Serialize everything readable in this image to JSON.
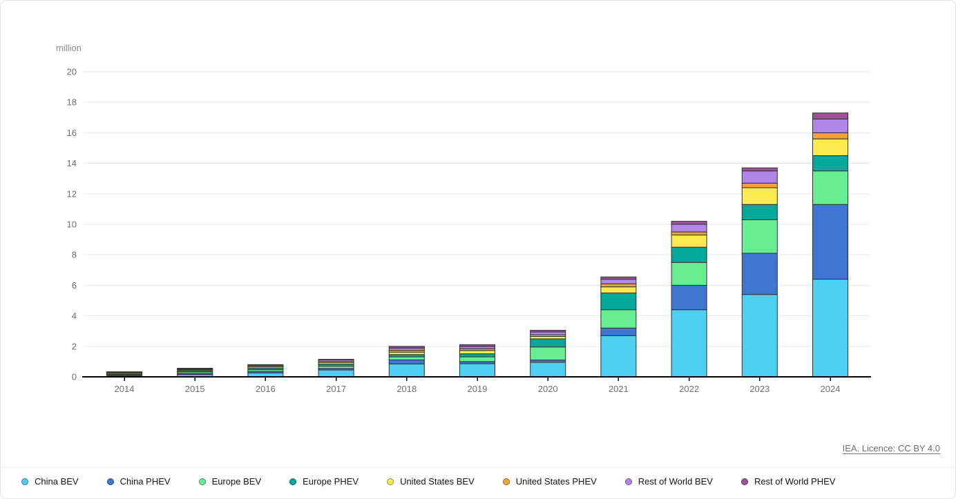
{
  "source": {
    "label": "IEA. Licence: CC BY 4.0"
  },
  "chart_data": {
    "type": "bar",
    "stacked": true,
    "title": "",
    "unit_label": "million",
    "xlabel": "",
    "ylabel": "million",
    "ylim": [
      0,
      20
    ],
    "ytick_step": 2,
    "grid": true,
    "legend_position": "bottom",
    "categories": [
      "2014",
      "2015",
      "2016",
      "2017",
      "2018",
      "2019",
      "2020",
      "2021",
      "2022",
      "2023",
      "2024"
    ],
    "series": [
      {
        "name": "China BEV",
        "color": "#4dd0f2",
        "values": [
          0.04,
          0.15,
          0.26,
          0.45,
          0.85,
          0.86,
          0.95,
          2.7,
          4.4,
          5.4,
          6.4
        ]
      },
      {
        "name": "China PHEV",
        "color": "#3f76d0",
        "values": [
          0.03,
          0.07,
          0.08,
          0.1,
          0.26,
          0.14,
          0.15,
          0.5,
          1.6,
          2.7,
          4.9
        ]
      },
      {
        "name": "Europe BEV",
        "color": "#67ee92",
        "values": [
          0.06,
          0.1,
          0.12,
          0.15,
          0.2,
          0.31,
          0.86,
          1.2,
          1.5,
          2.2,
          2.2
        ]
      },
      {
        "name": "Europe PHEV",
        "color": "#02a99a",
        "values": [
          0.04,
          0.08,
          0.1,
          0.13,
          0.15,
          0.2,
          0.53,
          1.1,
          1.0,
          1.0,
          1.0
        ]
      },
      {
        "name": "United States BEV",
        "color": "#fbeb51",
        "values": [
          0.06,
          0.06,
          0.09,
          0.1,
          0.16,
          0.22,
          0.16,
          0.4,
          0.8,
          1.1,
          1.1
        ]
      },
      {
        "name": "United States PHEV",
        "color": "#f2a43c",
        "values": [
          0.06,
          0.05,
          0.07,
          0.09,
          0.12,
          0.12,
          0.11,
          0.2,
          0.2,
          0.3,
          0.4
        ]
      },
      {
        "name": "Rest of World BEV",
        "color": "#b186e9",
        "values": [
          0.03,
          0.04,
          0.06,
          0.1,
          0.15,
          0.15,
          0.18,
          0.3,
          0.5,
          0.8,
          0.9
        ]
      },
      {
        "name": "Rest of World PHEV",
        "color": "#9d5199",
        "values": [
          0.01,
          0.01,
          0.02,
          0.03,
          0.11,
          0.11,
          0.11,
          0.15,
          0.2,
          0.2,
          0.4
        ]
      }
    ],
    "totals": [
      0.33,
      0.56,
      0.8,
      1.15,
      2.0,
      2.11,
      3.05,
      6.55,
      10.2,
      13.7,
      17.3
    ],
    "colors": {
      "grid": "#e9e9e9",
      "axis": "#000000",
      "tick_label": "#6f6f6f",
      "bar_outline": "#2f2f2f"
    }
  }
}
